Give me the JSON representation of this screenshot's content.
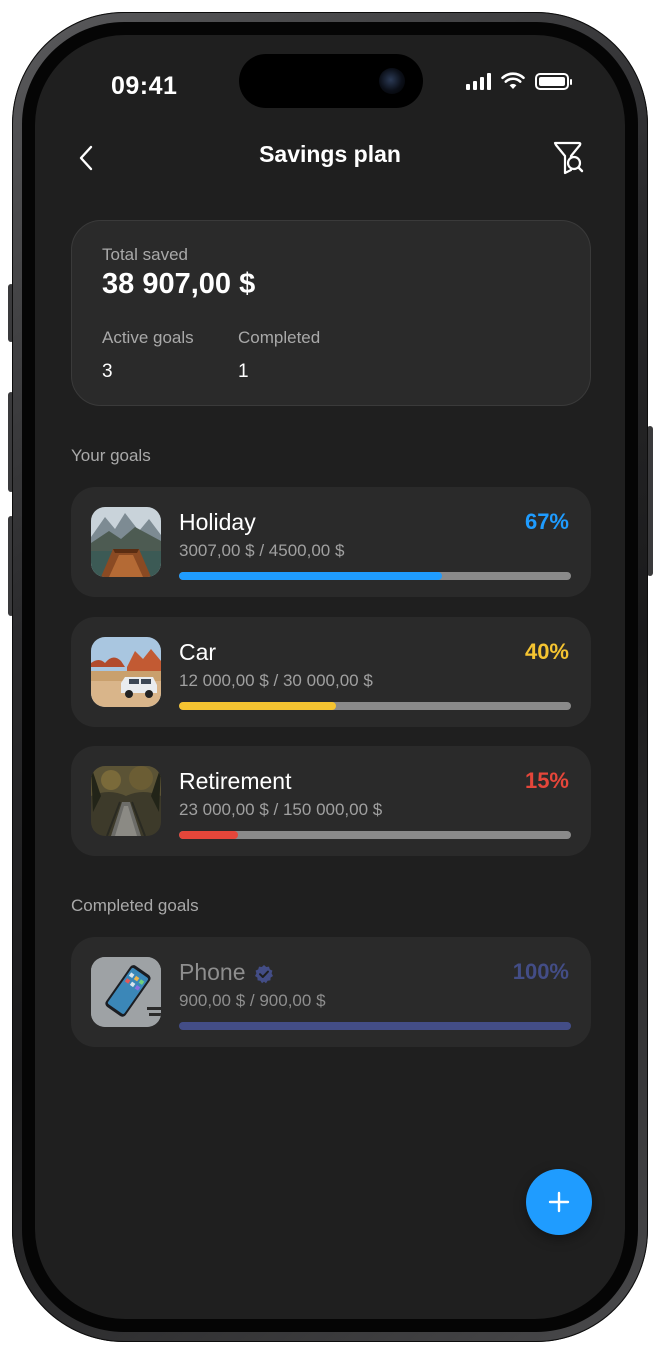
{
  "status_bar": {
    "time": "09:41"
  },
  "header": {
    "title": "Savings plan"
  },
  "summary": {
    "total_label": "Total saved",
    "total_amount": "38 907,00 $",
    "active_label": "Active goals",
    "active_value": "3",
    "completed_label": "Completed",
    "completed_value": "1"
  },
  "sections": {
    "your_goals": "Your goals",
    "completed_goals": "Completed goals"
  },
  "goals": [
    {
      "name": "Holiday",
      "amount": "3007,00 $ / 4500,00 $",
      "percent": "67%",
      "progress": 0.67,
      "color": "#1f9cff",
      "icon": "holiday-image"
    },
    {
      "name": "Car",
      "amount": "12 000,00 $ / 30 000,00 $",
      "percent": "40%",
      "progress": 0.4,
      "color": "#f5c431",
      "icon": "car-image"
    },
    {
      "name": "Retirement",
      "amount": "23 000,00 $ / 150 000,00 $",
      "percent": "15%",
      "progress": 0.15,
      "color": "#e5463a",
      "icon": "retirement-image"
    }
  ],
  "completed": [
    {
      "name": "Phone",
      "amount": "900,00 $ / 900,00 $",
      "percent": "100%",
      "progress": 1.0,
      "color": "#434d86",
      "icon": "phone-image"
    }
  ],
  "colors": {
    "background": "#1f1f1f",
    "card": "#2a2a2a",
    "accent": "#1f9cff"
  }
}
